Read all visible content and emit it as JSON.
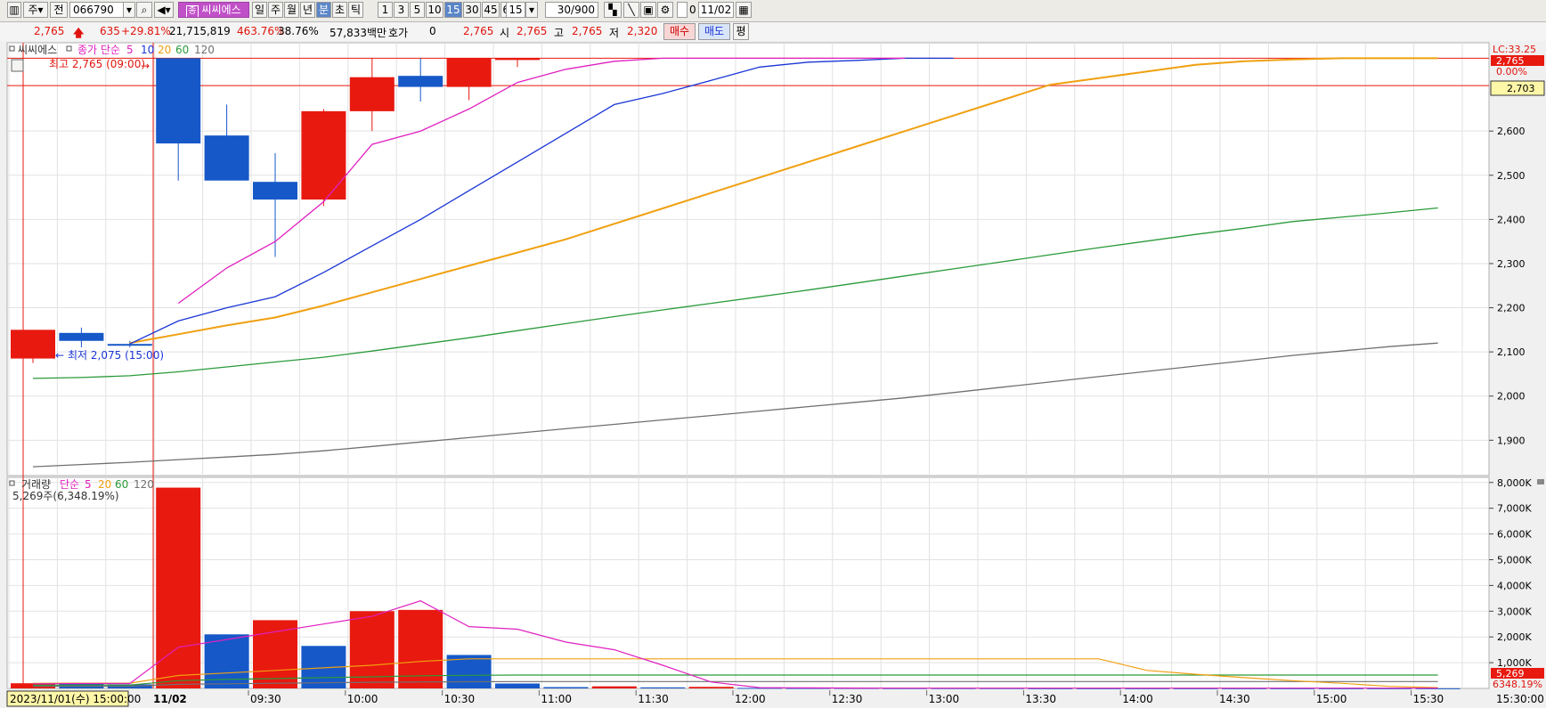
{
  "toolbar": {
    "period_label": "주",
    "prev_label": "전",
    "code": "066790",
    "stock_name": "씨씨에스",
    "stock_badge": "종",
    "range_buttons": [
      "일",
      "주",
      "월",
      "년",
      "분",
      "초",
      "틱"
    ],
    "range_active": "분",
    "minute_buttons": [
      "1",
      "3",
      "5",
      "10",
      "15",
      "30",
      "45",
      "60"
    ],
    "minute_active": "15",
    "minute_select": "15",
    "count": "30/900",
    "zero_label": "0",
    "date": "11/02"
  },
  "quote": {
    "price": "2,765",
    "change": "635",
    "change_pct": "+29.81%",
    "volume": "21,715,819",
    "vol_pct": "463.76%",
    "turnover": "38.76%",
    "amount": "57,833백만",
    "hoga_label": "호가",
    "hoga_value": "0",
    "cur": "2,765",
    "open_label": "시",
    "open": "2,765",
    "high_label": "고",
    "high": "2,765",
    "low_label": "저",
    "low": "2,320",
    "buy_label": "매수",
    "sell_label": "매도",
    "eval_label": "평"
  },
  "price_panel": {
    "name_label": "씨씨에스",
    "ma_label": "종가 단순",
    "ma_periods": [
      "5",
      "10",
      "20",
      "60",
      "120"
    ],
    "high_annot": "최고 2,765 (09:00)",
    "low_annot": "최저 2,075 (15:00)",
    "lc_label": "LC:33.25",
    "cur_box": "2,765",
    "pct_label": "0.00%",
    "ref_box": "2,703"
  },
  "volume_panel": {
    "name_label": "거래량",
    "ma_label": "단순",
    "ma_periods": [
      "5",
      "20",
      "60",
      "120"
    ],
    "info": "5,269주(6,348.19%)",
    "cur_box": "5,269",
    "pct_label": "6348.19%"
  },
  "time_axis": {
    "start_label": "2023/11/01(수) 15:00:00",
    "day_label": "11/02",
    "labels": [
      "09:30",
      "10:00",
      "10:30",
      "11:00",
      "11:30",
      "12:00",
      "12:30",
      "13:00",
      "13:30",
      "14:00",
      "14:30",
      "15:00",
      "15:30"
    ],
    "end_label": "15:30:00"
  },
  "chart_data": {
    "type": "candlestick",
    "interval": "30 minutes",
    "price_ticks": [
      "1,900",
      "2,000",
      "2,100",
      "2,200",
      "2,300",
      "2,400",
      "2,500",
      "2,600"
    ],
    "price_ylim": [
      1820,
      2800
    ],
    "volume_ticks": [
      "1,000K",
      "2,000K",
      "3,000K",
      "4,000K",
      "5,000K",
      "6,000K",
      "7,000K",
      "8,000K"
    ],
    "volume_ylim": [
      0,
      8200
    ],
    "colors": {
      "up": "#e8190f",
      "down": "#1658c8",
      "ma5": "#e020c0",
      "ma10": "#1a35d6",
      "ma20": "#f0a010",
      "ma60": "#2a9a3a",
      "ma120": "#707070"
    },
    "candles": [
      {
        "time": "11/01 14:00",
        "open": 2085,
        "high": 2150,
        "low": 2075,
        "close": 2150
      },
      {
        "time": "11/01 14:30",
        "open": 2143,
        "high": 2155,
        "low": 2110,
        "close": 2125
      },
      {
        "time": "11/01 15:00",
        "open": 2118,
        "high": 2125,
        "low": 2110,
        "close": 2115
      },
      {
        "time": "11/02 09:00",
        "open": 2765,
        "high": 2765,
        "low": 2488,
        "close": 2572
      },
      {
        "time": "11/02 09:30",
        "open": 2590,
        "high": 2660,
        "low": 2490,
        "close": 2488
      },
      {
        "time": "11/02 10:00",
        "open": 2485,
        "high": 2550,
        "low": 2315,
        "close": 2445
      },
      {
        "time": "11/02 10:30",
        "open": 2445,
        "high": 2650,
        "low": 2430,
        "close": 2645
      },
      {
        "time": "11/02 11:00",
        "open": 2645,
        "high": 2765,
        "low": 2600,
        "close": 2722
      },
      {
        "time": "11/02 11:30",
        "open": 2725,
        "high": 2765,
        "low": 2667,
        "close": 2700
      },
      {
        "time": "11/02 12:00",
        "open": 2700,
        "high": 2765,
        "low": 2670,
        "close": 2765
      },
      {
        "time": "11/02 12:30",
        "open": 2762,
        "high": 2765,
        "low": 2745,
        "close": 2765
      }
    ],
    "volumes": [
      200,
      210,
      160,
      7800,
      2100,
      2650,
      1650,
      3000,
      3050,
      1300,
      190,
      50,
      80,
      40,
      60,
      20,
      15,
      15,
      10,
      10,
      10,
      5,
      5,
      5,
      5,
      5,
      5,
      5,
      5,
      5
    ],
    "volume_up": [
      true,
      false,
      false,
      true,
      false,
      true,
      false,
      true,
      true,
      false,
      false,
      false,
      true,
      false,
      true,
      false,
      false,
      false,
      false,
      false,
      false,
      false,
      false,
      false,
      false,
      false,
      false,
      false,
      false,
      false
    ],
    "ma5": [
      [
        3,
        2210
      ],
      [
        4,
        2290
      ],
      [
        5,
        2350
      ],
      [
        6,
        2440
      ],
      [
        7,
        2570
      ],
      [
        8,
        2600
      ],
      [
        9,
        2650
      ],
      [
        10,
        2710
      ],
      [
        11,
        2740
      ],
      [
        12,
        2758
      ],
      [
        13,
        2765
      ],
      [
        14,
        2765
      ],
      [
        15,
        2765
      ],
      [
        16,
        2765
      ],
      [
        17,
        2765
      ],
      [
        18,
        2765
      ]
    ],
    "ma10": [
      [
        2,
        2118
      ],
      [
        3,
        2170
      ],
      [
        4,
        2200
      ],
      [
        5,
        2225
      ],
      [
        6,
        2280
      ],
      [
        7,
        2340
      ],
      [
        8,
        2400
      ],
      [
        9,
        2465
      ],
      [
        10,
        2530
      ],
      [
        11,
        2595
      ],
      [
        12,
        2660
      ],
      [
        13,
        2685
      ],
      [
        14,
        2715
      ],
      [
        15,
        2745
      ],
      [
        16,
        2756
      ],
      [
        17,
        2760
      ],
      [
        18,
        2765
      ],
      [
        19,
        2765
      ]
    ],
    "ma20": [
      [
        2,
        2120
      ],
      [
        3,
        2140
      ],
      [
        4,
        2160
      ],
      [
        5,
        2178
      ],
      [
        6,
        2205
      ],
      [
        7,
        2235
      ],
      [
        8,
        2265
      ],
      [
        9,
        2295
      ],
      [
        10,
        2325
      ],
      [
        11,
        2355
      ],
      [
        12,
        2390
      ],
      [
        13,
        2425
      ],
      [
        14,
        2460
      ],
      [
        15,
        2495
      ],
      [
        16,
        2530
      ],
      [
        17,
        2565
      ],
      [
        18,
        2600
      ],
      [
        19,
        2635
      ],
      [
        20,
        2670
      ],
      [
        21,
        2705
      ],
      [
        22,
        2720
      ],
      [
        23,
        2735
      ],
      [
        24,
        2750
      ],
      [
        25,
        2758
      ],
      [
        26,
        2762
      ],
      [
        27,
        2765
      ],
      [
        28,
        2765
      ],
      [
        29,
        2765
      ]
    ],
    "ma60": [
      [
        0,
        2040
      ],
      [
        1,
        2042
      ],
      [
        2,
        2046
      ],
      [
        3,
        2055
      ],
      [
        4,
        2066
      ],
      [
        5,
        2077
      ],
      [
        6,
        2088
      ],
      [
        7,
        2102
      ],
      [
        8,
        2117
      ],
      [
        9,
        2132
      ],
      [
        10,
        2148
      ],
      [
        11,
        2164
      ],
      [
        12,
        2180
      ],
      [
        13,
        2195
      ],
      [
        14,
        2210
      ],
      [
        15,
        2225
      ],
      [
        16,
        2240
      ],
      [
        17,
        2256
      ],
      [
        18,
        2272
      ],
      [
        19,
        2288
      ],
      [
        20,
        2304
      ],
      [
        21,
        2320
      ],
      [
        22,
        2336
      ],
      [
        23,
        2351
      ],
      [
        24,
        2366
      ],
      [
        25,
        2380
      ],
      [
        26,
        2395
      ],
      [
        27,
        2405
      ],
      [
        28,
        2415
      ],
      [
        29,
        2426
      ]
    ],
    "ma120": [
      [
        0,
        1840
      ],
      [
        1,
        1845
      ],
      [
        2,
        1850
      ],
      [
        3,
        1856
      ],
      [
        4,
        1862
      ],
      [
        5,
        1868
      ],
      [
        6,
        1876
      ],
      [
        7,
        1886
      ],
      [
        8,
        1896
      ],
      [
        9,
        1906
      ],
      [
        10,
        1916
      ],
      [
        11,
        1926
      ],
      [
        12,
        1936
      ],
      [
        13,
        1946
      ],
      [
        14,
        1956
      ],
      [
        15,
        1966
      ],
      [
        16,
        1976
      ],
      [
        17,
        1986
      ],
      [
        18,
        1996
      ],
      [
        19,
        2008
      ],
      [
        20,
        2020
      ],
      [
        21,
        2032
      ],
      [
        22,
        2044
      ],
      [
        23,
        2056
      ],
      [
        24,
        2068
      ],
      [
        25,
        2080
      ],
      [
        26,
        2092
      ],
      [
        27,
        2102
      ],
      [
        28,
        2112
      ],
      [
        29,
        2120
      ]
    ],
    "vol_ma5": [
      [
        0,
        180
      ],
      [
        1,
        190
      ],
      [
        2,
        190
      ],
      [
        3,
        1600
      ],
      [
        4,
        1900
      ],
      [
        5,
        2200
      ],
      [
        6,
        2500
      ],
      [
        7,
        2800
      ],
      [
        8,
        3400
      ],
      [
        9,
        2400
      ],
      [
        10,
        2300
      ],
      [
        11,
        1800
      ],
      [
        12,
        1500
      ],
      [
        13,
        900
      ],
      [
        14,
        250
      ],
      [
        15,
        30
      ],
      [
        16,
        20
      ],
      [
        17,
        15
      ],
      [
        18,
        10
      ],
      [
        19,
        10
      ],
      [
        20,
        10
      ],
      [
        21,
        10
      ],
      [
        22,
        10
      ],
      [
        23,
        10
      ],
      [
        24,
        10
      ],
      [
        25,
        10
      ],
      [
        26,
        10
      ],
      [
        27,
        10
      ],
      [
        28,
        10
      ],
      [
        29,
        10
      ]
    ],
    "vol_ma20": [
      [
        0,
        200
      ],
      [
        1,
        205
      ],
      [
        2,
        205
      ],
      [
        3,
        500
      ],
      [
        4,
        600
      ],
      [
        5,
        700
      ],
      [
        6,
        800
      ],
      [
        7,
        900
      ],
      [
        8,
        1050
      ],
      [
        9,
        1150
      ],
      [
        10,
        1150
      ],
      [
        11,
        1150
      ],
      [
        12,
        1150
      ],
      [
        13,
        1150
      ],
      [
        14,
        1150
      ],
      [
        15,
        1150
      ],
      [
        16,
        1150
      ],
      [
        17,
        1150
      ],
      [
        18,
        1150
      ],
      [
        19,
        1150
      ],
      [
        20,
        1150
      ],
      [
        21,
        1150
      ],
      [
        22,
        1150
      ],
      [
        23,
        700
      ],
      [
        24,
        550
      ],
      [
        25,
        420
      ],
      [
        26,
        300
      ],
      [
        27,
        200
      ],
      [
        28,
        80
      ],
      [
        29,
        30
      ]
    ],
    "vol_ma60": [
      [
        0,
        120
      ],
      [
        1,
        130
      ],
      [
        2,
        130
      ],
      [
        3,
        300
      ],
      [
        4,
        350
      ],
      [
        5,
        380
      ],
      [
        6,
        420
      ],
      [
        7,
        450
      ],
      [
        8,
        490
      ],
      [
        9,
        510
      ],
      [
        10,
        520
      ],
      [
        11,
        520
      ],
      [
        12,
        520
      ],
      [
        13,
        520
      ],
      [
        14,
        520
      ],
      [
        15,
        520
      ],
      [
        16,
        520
      ],
      [
        17,
        520
      ],
      [
        18,
        520
      ],
      [
        19,
        520
      ],
      [
        20,
        520
      ],
      [
        21,
        520
      ],
      [
        22,
        520
      ],
      [
        23,
        520
      ],
      [
        24,
        520
      ],
      [
        25,
        520
      ],
      [
        26,
        520
      ],
      [
        27,
        520
      ],
      [
        28,
        520
      ],
      [
        29,
        520
      ]
    ],
    "vol_ma120": [
      [
        0,
        80
      ],
      [
        1,
        85
      ],
      [
        2,
        85
      ],
      [
        3,
        160
      ],
      [
        4,
        180
      ],
      [
        5,
        200
      ],
      [
        6,
        220
      ],
      [
        7,
        240
      ],
      [
        8,
        250
      ],
      [
        9,
        260
      ],
      [
        10,
        265
      ],
      [
        11,
        265
      ],
      [
        12,
        265
      ],
      [
        13,
        265
      ],
      [
        14,
        265
      ],
      [
        15,
        265
      ],
      [
        16,
        265
      ],
      [
        17,
        265
      ],
      [
        18,
        265
      ],
      [
        19,
        265
      ],
      [
        20,
        265
      ],
      [
        21,
        265
      ],
      [
        22,
        265
      ],
      [
        23,
        265
      ],
      [
        24,
        265
      ],
      [
        25,
        265
      ],
      [
        26,
        265
      ],
      [
        27,
        265
      ],
      [
        28,
        265
      ],
      [
        29,
        265
      ]
    ],
    "reference_lines": {
      "high": 2765,
      "ref": 2703
    }
  }
}
